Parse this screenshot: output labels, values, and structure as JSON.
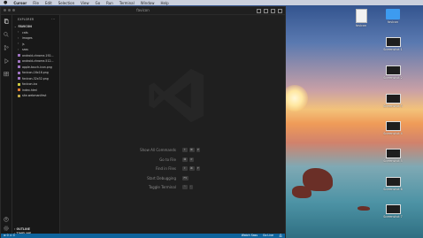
{
  "menubar": {
    "app_name": "Cursor",
    "items": [
      "File",
      "Edit",
      "Selection",
      "View",
      "Go",
      "Run",
      "Terminal",
      "Window",
      "Help"
    ]
  },
  "window": {
    "title": "favicon"
  },
  "sidebar": {
    "header": "EXPLORER",
    "section": "FAVICON",
    "items": [
      {
        "label": "cats",
        "kind": "folder",
        "indent": 1
      },
      {
        "label": "images",
        "kind": "folder",
        "indent": 1
      },
      {
        "label": "js",
        "kind": "folder",
        "indent": 1
      },
      {
        "label": "sass",
        "kind": "folder",
        "indent": 1
      },
      {
        "label": "android-chrome-192...",
        "kind": "image",
        "indent": 1
      },
      {
        "label": "android-chrome-512...",
        "kind": "image",
        "indent": 1
      },
      {
        "label": "apple-touch-icon.png",
        "kind": "image",
        "indent": 1
      },
      {
        "label": "favicon-16x16.png",
        "kind": "image",
        "indent": 1
      },
      {
        "label": "favicon-32x32.png",
        "kind": "image",
        "indent": 1
      },
      {
        "label": "favicon.ico",
        "kind": "ico",
        "indent": 1
      },
      {
        "label": "index.html",
        "kind": "html",
        "indent": 1
      },
      {
        "label": "site.webmanifest",
        "kind": "json",
        "indent": 1
      }
    ],
    "outline": "OUTLINE",
    "timeline": "TIMELINE"
  },
  "editor": {
    "shortcuts": [
      {
        "label": "Show All Commands",
        "keys": [
          "⇧",
          "⌘",
          "P"
        ]
      },
      {
        "label": "Go to File",
        "keys": [
          "⌘",
          "P"
        ]
      },
      {
        "label": "Find in Files",
        "keys": [
          "⇧",
          "⌘",
          "F"
        ]
      },
      {
        "label": "Start Debugging",
        "keys": [
          "F5"
        ]
      },
      {
        "label": "Toggle Terminal",
        "keys": [
          "⌃",
          "`"
        ]
      }
    ]
  },
  "statusbar": {
    "left": "⊗ 0 ⚠ 0",
    "right": [
      "Watch Sass",
      "Go Live"
    ]
  },
  "desktop": {
    "items": [
      {
        "label": "favicon",
        "kind": "file"
      },
      {
        "label": "favicon",
        "kind": "folder"
      },
      {
        "label": "Screenshot 1",
        "kind": "screenshot"
      },
      {
        "label": "Screenshot 2",
        "kind": "screenshot"
      },
      {
        "label": "Screenshot 3",
        "kind": "screenshot"
      },
      {
        "label": "Screenshot 4",
        "kind": "screenshot"
      },
      {
        "label": "Screenshot 5",
        "kind": "screenshot"
      },
      {
        "label": "Screenshot 6",
        "kind": "screenshot"
      },
      {
        "label": "Screenshot 7",
        "kind": "screenshot"
      }
    ]
  },
  "colors": {
    "accent": "#0e639c",
    "folder": "#3d9bf0",
    "image_icon": "#a074c4",
    "html_icon": "#e37933",
    "ico_icon": "#cbcb41"
  }
}
